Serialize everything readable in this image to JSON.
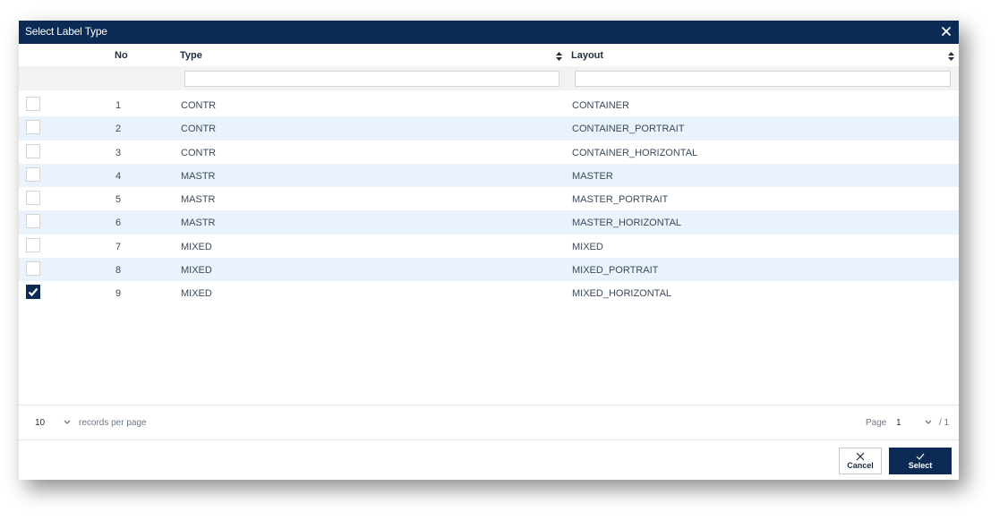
{
  "dialog": {
    "title": "Select Label Type",
    "close_icon": "close-icon"
  },
  "table": {
    "columns": [
      {
        "key": "no",
        "label": "No",
        "sortable": false
      },
      {
        "key": "type",
        "label": "Type",
        "sortable": true
      },
      {
        "key": "layout",
        "label": "Layout",
        "sortable": true
      }
    ],
    "filters": {
      "type": "",
      "layout": ""
    },
    "rows": [
      {
        "no": "1",
        "type": "CONTR",
        "layout": "CONTAINER",
        "checked": false
      },
      {
        "no": "2",
        "type": "CONTR",
        "layout": "CONTAINER_PORTRAIT",
        "checked": false
      },
      {
        "no": "3",
        "type": "CONTR",
        "layout": "CONTAINER_HORIZONTAL",
        "checked": false
      },
      {
        "no": "4",
        "type": "MASTR",
        "layout": "MASTER",
        "checked": false
      },
      {
        "no": "5",
        "type": "MASTR",
        "layout": "MASTER_PORTRAIT",
        "checked": false
      },
      {
        "no": "6",
        "type": "MASTR",
        "layout": "MASTER_HORIZONTAL",
        "checked": false
      },
      {
        "no": "7",
        "type": "MIXED",
        "layout": "MIXED",
        "checked": false
      },
      {
        "no": "8",
        "type": "MIXED",
        "layout": "MIXED_PORTRAIT",
        "checked": false
      },
      {
        "no": "9",
        "type": "MIXED",
        "layout": "MIXED_HORIZONTAL",
        "checked": true
      }
    ]
  },
  "pager": {
    "per_page_value": "10",
    "per_page_label": "records per page",
    "page_label": "Page",
    "page_value": "1",
    "page_total": "/ 1"
  },
  "buttons": {
    "cancel_label": "Cancel",
    "select_label": "Select"
  },
  "colors": {
    "header_bg": "#0b2a55",
    "row_alt_bg": "#eaf3fc",
    "filter_bg": "#f2f2f2"
  }
}
